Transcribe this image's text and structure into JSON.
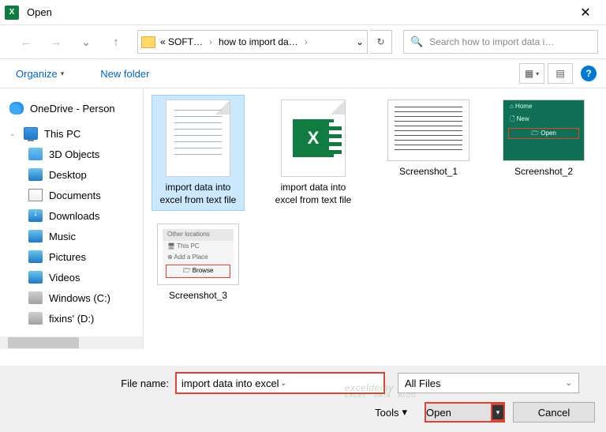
{
  "window": {
    "title": "Open",
    "close": "✕"
  },
  "nav": {
    "back": "←",
    "fwd": "→",
    "up": "↑",
    "crumb1": "« SOFT…",
    "crumb2": "how to import da…",
    "dropdown": "⌄",
    "refresh": "↻",
    "search_placeholder": "Search how to import data i…",
    "search_icon": "🔍"
  },
  "toolbar": {
    "organize": "Organize",
    "chev": "▾",
    "newfolder": "New folder",
    "view1": "▦",
    "view2": "▤",
    "help": "?"
  },
  "sidebar": {
    "onedrive": "OneDrive - Person",
    "thispc": "This PC",
    "items": [
      {
        "label": "3D Objects"
      },
      {
        "label": "Desktop"
      },
      {
        "label": "Documents"
      },
      {
        "label": "Downloads"
      },
      {
        "label": "Music"
      },
      {
        "label": "Pictures"
      },
      {
        "label": "Videos"
      },
      {
        "label": "Windows (C:)"
      },
      {
        "label": "fixins' (D:)"
      }
    ]
  },
  "files": {
    "f0": "import data into excel from text file",
    "f1": "import data into excel from text file",
    "f2": "Screenshot_1",
    "f3": "Screenshot_2",
    "f4": "Screenshot_3",
    "ss2_home": "⌂ Home",
    "ss2_new": "🗋 New",
    "ss2_open": "🗁 Open",
    "ss3_hdr": "Other locations",
    "ss3_pc": "🖥 This PC",
    "ss3_add": "⊕ Add a Place",
    "ss3_browse": "🗁 Browse"
  },
  "bottom": {
    "fn_label": "File name:",
    "fn_value": "import data into excel from text file",
    "type_value": "All Files",
    "tools": "Tools",
    "chev": "▾",
    "open": "Open",
    "open_chev": "▾",
    "cancel": "Cancel"
  },
  "watermark": {
    "main": "exceldemy",
    "sub": "EXCEL · DATA · BLOG"
  }
}
